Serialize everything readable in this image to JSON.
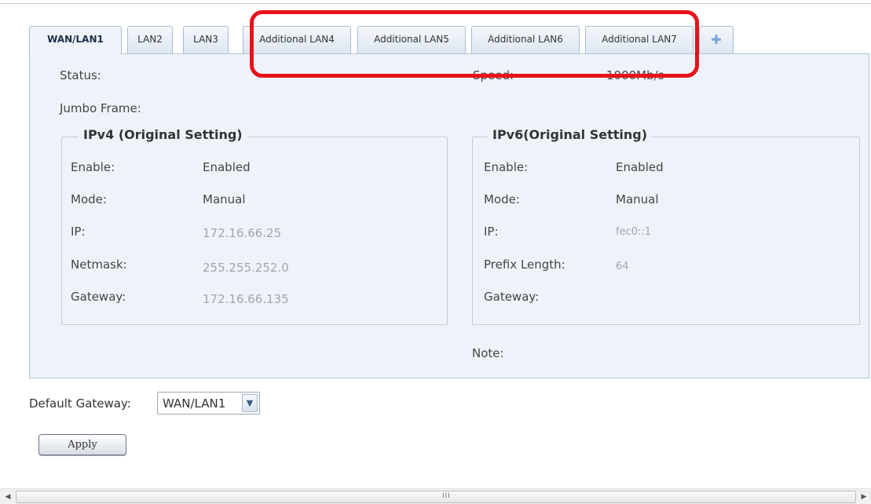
{
  "tabs": [
    {
      "label": "WAN/LAN1",
      "active": true
    },
    {
      "label": "LAN2"
    },
    {
      "label": "LAN3"
    },
    {
      "label": "Additional LAN4"
    },
    {
      "label": "Additional LAN5"
    },
    {
      "label": "Additional LAN6"
    },
    {
      "label": "Additional LAN7"
    }
  ],
  "tab_add_icon": "plus-icon",
  "status": {
    "label": "Status:"
  },
  "speed": {
    "label": "Speed:",
    "value": "1000Mb/s"
  },
  "jumbo": {
    "label": "Jumbo Frame:"
  },
  "note": {
    "label": "Note:"
  },
  "ipv4": {
    "title": "IPv4 (Original Setting)",
    "rows": [
      {
        "label": "Enable:",
        "value": "Enabled"
      },
      {
        "label": "Mode:",
        "value": "Manual"
      },
      {
        "label": "IP:",
        "value": "172.16.66.25"
      },
      {
        "label": "Netmask:",
        "value": "255.255.252.0"
      },
      {
        "label": "Gateway:",
        "value": "172.16.66.135"
      }
    ]
  },
  "ipv6": {
    "title": "IPv6(Original Setting)",
    "rows": [
      {
        "label": "Enable:",
        "value": "Enabled"
      },
      {
        "label": "Mode:",
        "value": "Manual"
      },
      {
        "label": "IP:",
        "value": "fec0::1"
      },
      {
        "label": "Prefix Length:",
        "value": "64"
      },
      {
        "label": "Gateway:",
        "value": ""
      }
    ]
  },
  "default_gateway": {
    "label": "Default Gateway:",
    "selected": "WAN/LAN1"
  },
  "apply_label": "Apply",
  "scrollbar": {
    "grip": "III"
  },
  "colors": {
    "highlight": "#e8121a",
    "panel_bg": "#eef3fa",
    "tab_border": "#a9bcd3"
  }
}
